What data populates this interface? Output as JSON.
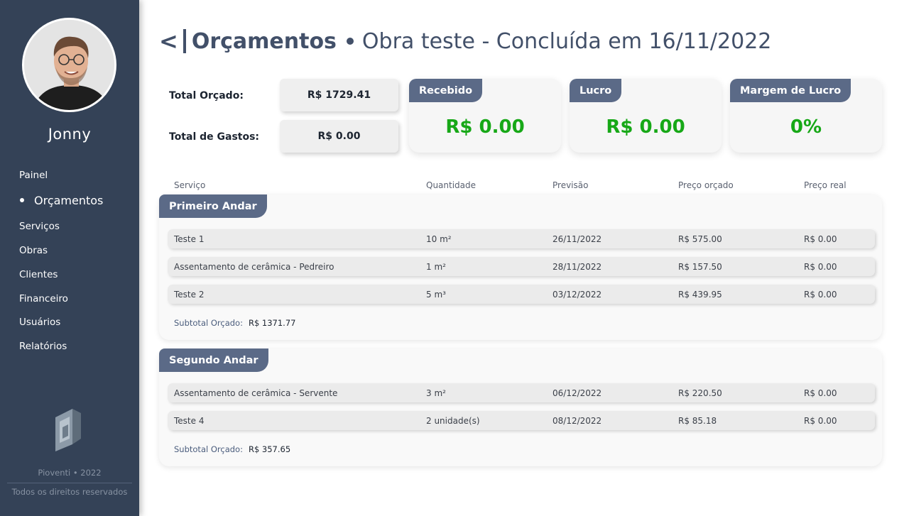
{
  "user": {
    "name": "Jonny"
  },
  "nav": {
    "items": [
      {
        "label": "Painel",
        "active": false
      },
      {
        "label": "Orçamentos",
        "active": true
      },
      {
        "label": "Serviços",
        "active": false
      },
      {
        "label": "Obras",
        "active": false
      },
      {
        "label": "Clientes",
        "active": false
      },
      {
        "label": "Financeiro",
        "active": false
      },
      {
        "label": "Usuários",
        "active": false
      },
      {
        "label": "Relatórios",
        "active": false
      }
    ]
  },
  "footer": {
    "brand": "Pioventi • 2022",
    "rights": "Todos os direitos reservados"
  },
  "header": {
    "back": "<",
    "title": "Orçamentos",
    "subtitle": "Obra teste - Concluída em 16/11/2022"
  },
  "totals": {
    "orcado_label": "Total Orçado:",
    "orcado_value": "R$ 1729.41",
    "gastos_label": "Total de Gastos:",
    "gastos_value": "R$ 0.00"
  },
  "cards": {
    "recebido": {
      "label": "Recebido",
      "value": "R$ 0.00"
    },
    "lucro": {
      "label": "Lucro",
      "value": "R$ 0.00"
    },
    "margem": {
      "label": "Margem de Lucro",
      "value": "0%"
    }
  },
  "columns": [
    "Serviço",
    "Quantidade",
    "Previsão",
    "Preço orçado",
    "Preço real"
  ],
  "sections": [
    {
      "name": "Primeiro Andar",
      "rows": [
        [
          "Teste 1",
          "10 m²",
          "26/11/2022",
          "R$ 575.00",
          "R$ 0.00"
        ],
        [
          "Assentamento de cerâmica - Pedreiro",
          "1 m²",
          "28/11/2022",
          "R$ 157.50",
          "R$ 0.00"
        ],
        [
          "Teste 2",
          "5 m³",
          "03/12/2022",
          "R$ 439.95",
          "R$ 0.00"
        ]
      ],
      "subtotal_label": "Subtotal Orçado:",
      "subtotal_value": "R$ 1371.77"
    },
    {
      "name": "Segundo Andar",
      "rows": [
        [
          "Assentamento de cerâmica - Servente",
          "3 m²",
          "06/12/2022",
          "R$ 220.50",
          "R$ 0.00"
        ],
        [
          "Teste 4",
          "2 unidade(s)",
          "08/12/2022",
          "R$ 85.18",
          "R$ 0.00"
        ]
      ],
      "subtotal_label": "Subtotal Orçado:",
      "subtotal_value": "R$ 357.65"
    }
  ],
  "colors": {
    "sidebar": "#344257",
    "accent": "#5b6a87",
    "positive": "#17a817",
    "title": "#425069"
  }
}
